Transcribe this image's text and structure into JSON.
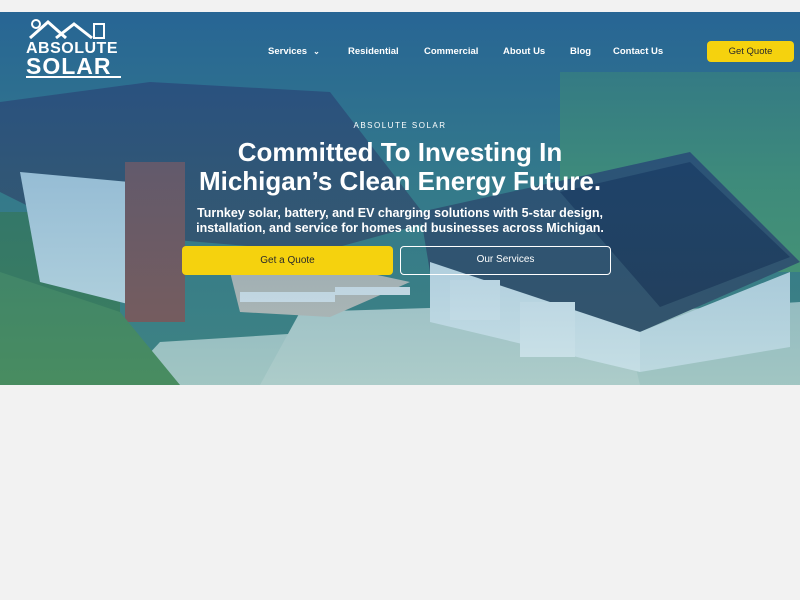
{
  "brand": {
    "line1": "ABSOLUTE",
    "line2": "SOLAR"
  },
  "nav": {
    "items": [
      {
        "label": "Services",
        "has_dropdown": true
      },
      {
        "label": "Residential"
      },
      {
        "label": "Commercial"
      },
      {
        "label": "About Us"
      },
      {
        "label": "Blog"
      },
      {
        "label": "Contact Us"
      }
    ],
    "cta_label": "Get Quote"
  },
  "hero": {
    "eyebrow": "ABSOLUTE SOLAR",
    "headline_line1": "Committed To Investing In",
    "headline_line2": "Michigan’s Clean Energy Future.",
    "subhead_line1": "Turnkey solar, battery, and EV charging solutions with 5-star design,",
    "subhead_line2": "installation, and service for homes and businesses across Michigan.",
    "primary_cta": "Get a Quote",
    "secondary_cta": "Our Services"
  },
  "colors": {
    "accent": "#f5d20e",
    "overlay": "#1e5aa8",
    "page_bg": "#f2f2f2"
  },
  "icons": [
    "house-solar-logo-icon",
    "chevron-down-icon"
  ]
}
